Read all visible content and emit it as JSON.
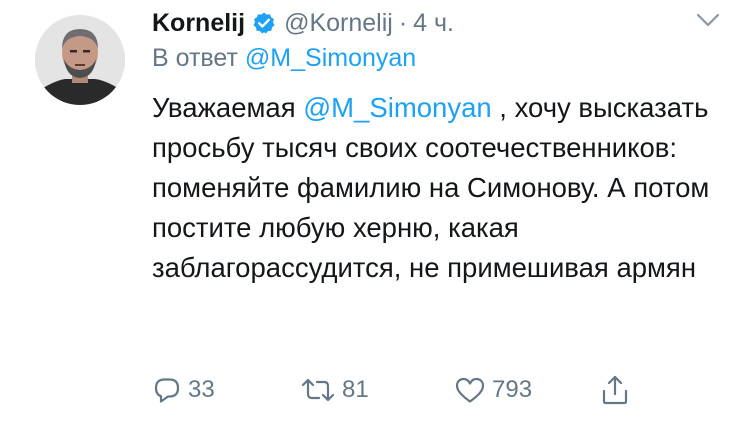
{
  "tweet": {
    "author": {
      "display_name": "Kornelij",
      "handle": "@Kornelij",
      "separator": "·",
      "time": "4 ч.",
      "verified": true
    },
    "reply_to": {
      "prefix": "В ответ",
      "mention": "@M_Simonyan"
    },
    "body": {
      "before": "Уважаемая",
      "mention": "@M_Simonyan",
      "after": " , хочу высказать просьбу тысяч своих соотечественников: поменяйте фамилию на Симонову. А потом постите любую херню, какая заблагорассудится, не примешивая армян"
    },
    "actions": {
      "reply_count": "33",
      "retweet_count": "81",
      "like_count": "793"
    }
  },
  "colors": {
    "link": "#1da1f2",
    "secondary_text": "#657786",
    "primary_text": "#14171a",
    "verified_badge": "#1da1f2"
  },
  "icons": {
    "reply": "speech-bubble-icon",
    "retweet": "retweet-arrows-icon",
    "like": "heart-icon",
    "share": "share-upload-icon",
    "menu": "chevron-down-icon",
    "verified": "verified-badge-icon"
  }
}
